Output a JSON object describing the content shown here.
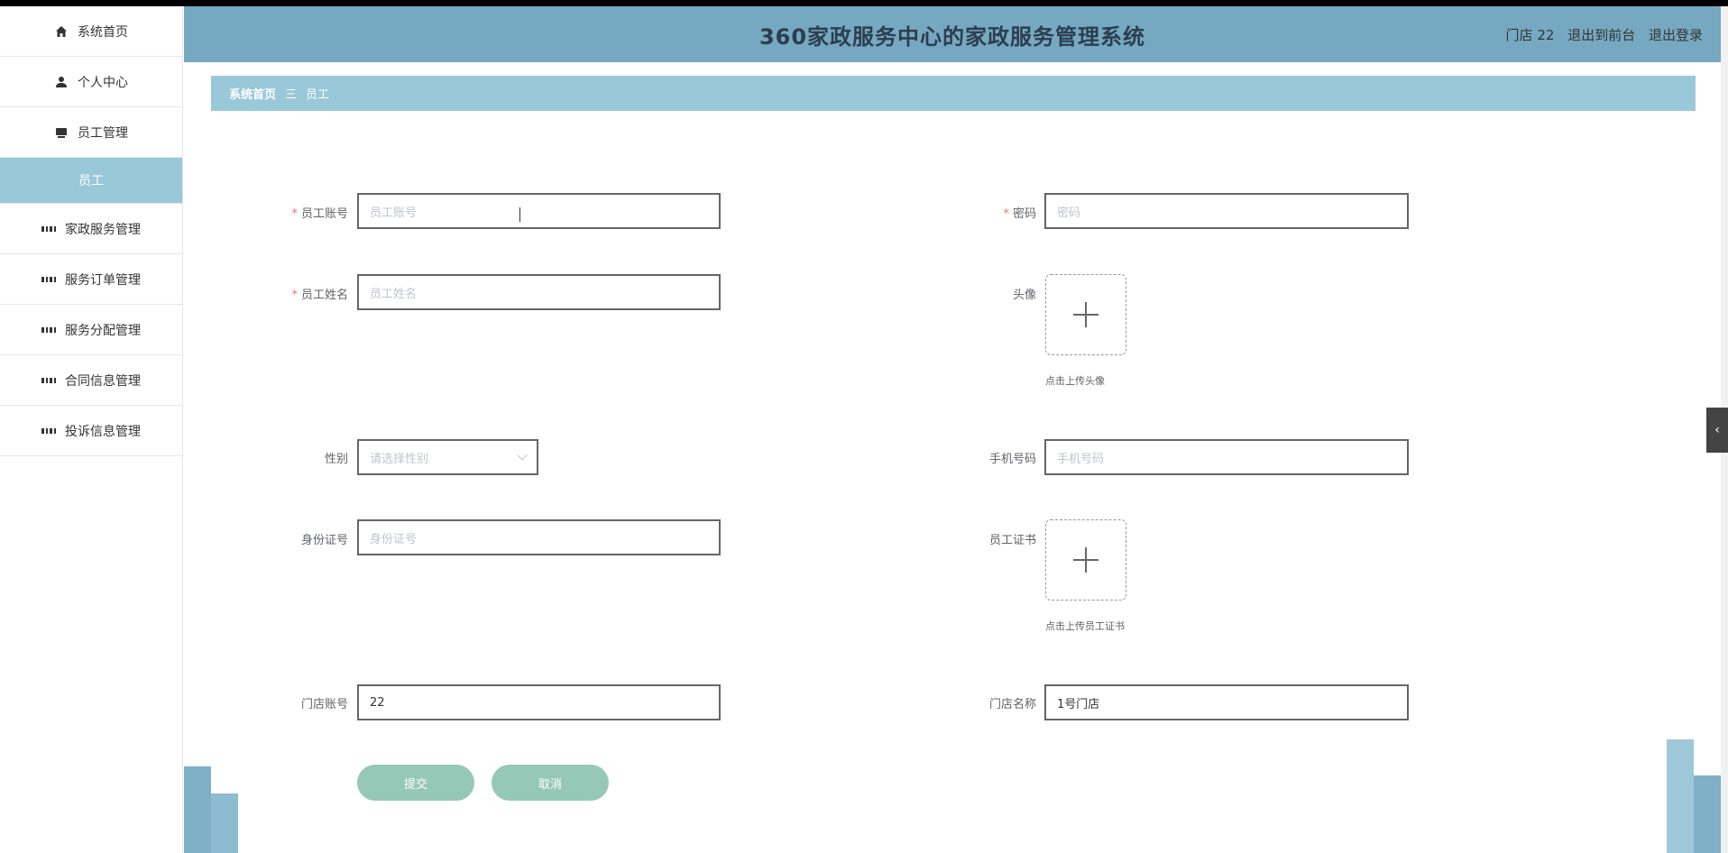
{
  "header": {
    "title": "360家政服务中心的家政服务管理系统",
    "user": "门店 22",
    "to_front": "退出到前台",
    "logout": "退出登录"
  },
  "sidebar": {
    "items": [
      {
        "label": "系统首页",
        "icon": "home-icon"
      },
      {
        "label": "个人中心",
        "icon": "user-icon"
      },
      {
        "label": "员工管理",
        "icon": "briefcase-icon"
      },
      {
        "label": "员工",
        "icon": ""
      },
      {
        "label": "家政服务管理",
        "icon": "grid-icon"
      },
      {
        "label": "服务订单管理",
        "icon": "grid-icon"
      },
      {
        "label": "服务分配管理",
        "icon": "grid-icon"
      },
      {
        "label": "合同信息管理",
        "icon": "grid-icon"
      },
      {
        "label": "投诉信息管理",
        "icon": "grid-icon"
      }
    ]
  },
  "breadcrumb": {
    "home": "系统首页",
    "sep": "三",
    "current": "员工"
  },
  "form": {
    "account": {
      "label": "员工账号",
      "placeholder": "员工账号",
      "value": ""
    },
    "password": {
      "label": "密码",
      "placeholder": "密码",
      "value": ""
    },
    "name": {
      "label": "员工姓名",
      "placeholder": "员工姓名",
      "value": ""
    },
    "avatar": {
      "label": "头像",
      "tip": "点击上传头像"
    },
    "gender": {
      "label": "性别",
      "placeholder": "请选择性别"
    },
    "phone": {
      "label": "手机号码",
      "placeholder": "手机号码"
    },
    "id_card": {
      "label": "身份证号",
      "placeholder": "身份证号"
    },
    "certificate": {
      "label": "员工证书",
      "tip": "点击上传员工证书"
    },
    "store_account": {
      "label": "门店账号",
      "value": "22"
    },
    "store_name": {
      "label": "门店名称",
      "value": "1号门店"
    },
    "required_mark": "*",
    "submit": "提交",
    "cancel": "取消"
  },
  "colors": {
    "header_bg": "#76a9c1",
    "breadcrumb_bg": "#99c8d9",
    "button_bg": "#96c8b7",
    "required": "#f56c6c"
  }
}
